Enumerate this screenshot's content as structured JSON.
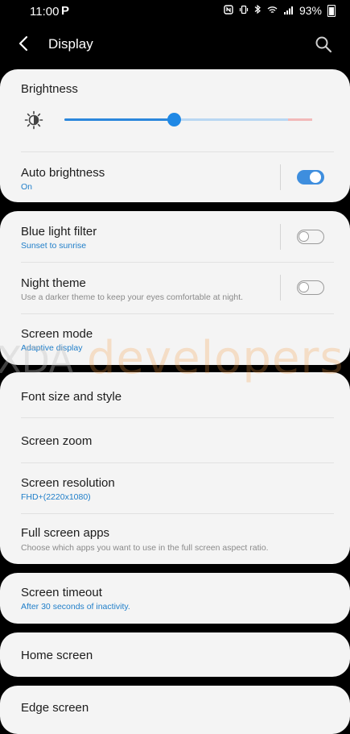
{
  "status": {
    "time": "11:00",
    "carrier_icon_label": "P",
    "battery": "93%",
    "icons": [
      "nfc-icon",
      "vibrate-icon",
      "bluetooth-icon",
      "wifi-icon",
      "signal-icon"
    ]
  },
  "appbar": {
    "title": "Display"
  },
  "brightness": {
    "title": "Brightness",
    "level_fraction": 0.44
  },
  "auto_brightness": {
    "title": "Auto brightness",
    "subtitle": "On",
    "enabled": true
  },
  "blue_light": {
    "title": "Blue light filter",
    "subtitle": "Sunset to sunrise",
    "enabled": false
  },
  "night_theme": {
    "title": "Night theme",
    "subtitle": "Use a darker theme to keep your eyes comfortable at night.",
    "enabled": false
  },
  "screen_mode": {
    "title": "Screen mode",
    "subtitle": "Adaptive display"
  },
  "font": {
    "title": "Font size and style"
  },
  "zoom": {
    "title": "Screen zoom"
  },
  "resolution": {
    "title": "Screen resolution",
    "subtitle": "FHD+(2220x1080)"
  },
  "full_screen": {
    "title": "Full screen apps",
    "subtitle": "Choose which apps you want to use in the full screen aspect ratio."
  },
  "timeout": {
    "title": "Screen timeout",
    "subtitle": "After 30 seconds of inactivity."
  },
  "home": {
    "title": "Home screen"
  },
  "edge": {
    "title": "Edge screen"
  },
  "watermark": {
    "part1": "XDA",
    "part2": "developers"
  },
  "colors": {
    "accent": "#3e8ede",
    "link": "#1f7ec9",
    "card": "#f4f4f4",
    "background": "#000000"
  }
}
